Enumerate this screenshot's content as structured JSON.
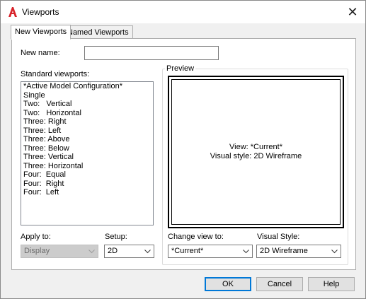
{
  "window": {
    "title": "Viewports",
    "close_glyph": "✕",
    "accent_icon_color": "#d8232a"
  },
  "tabs": [
    {
      "label": "New Viewports",
      "active": true
    },
    {
      "label": "Named Viewports",
      "active": false
    }
  ],
  "new_name": {
    "label": "New name:",
    "value": ""
  },
  "standard_viewports": {
    "label": "Standard viewports:",
    "items": [
      "*Active Model Configuration*",
      "Single",
      "Two:   Vertical",
      "Two:   Horizontal",
      "Three: Right",
      "Three: Left",
      "Three: Above",
      "Three: Below",
      "Three: Vertical",
      "Three: Horizontal",
      "Four:  Equal",
      "Four:  Right",
      "Four:  Left"
    ]
  },
  "preview": {
    "legend": "Preview",
    "view_line": "View: *Current*",
    "style_line": "Visual style: 2D Wireframe"
  },
  "apply_to": {
    "label": "Apply to:",
    "value": "Display",
    "enabled": false
  },
  "setup": {
    "label": "Setup:",
    "value": "2D"
  },
  "change_view_to": {
    "label": "Change view to:",
    "value": "*Current*"
  },
  "visual_style": {
    "label": "Visual Style:",
    "value": "2D Wireframe"
  },
  "buttons": {
    "ok": "OK",
    "cancel": "Cancel",
    "help": "Help"
  }
}
